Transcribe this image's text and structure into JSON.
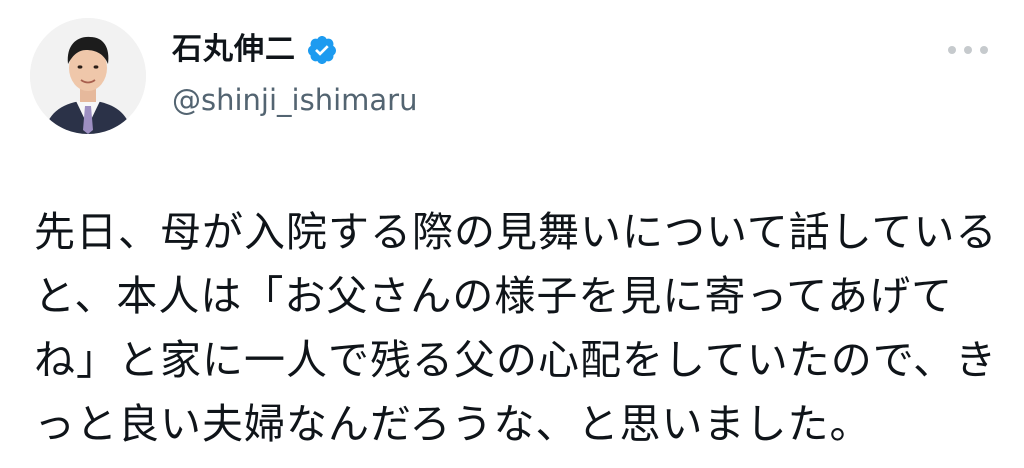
{
  "author": {
    "display_name": "石丸伸二",
    "handle": "@shinji_ishimaru",
    "verified": true,
    "avatar_icon": "profile-photo"
  },
  "menu": {
    "icon": "more-horizontal-icon"
  },
  "tweet": {
    "lines": [
      "先日、母が入院する際の見舞いについて話している",
      "と、本人は「お父さんの様子を見に寄ってあげて",
      "ね」と家に一人で残る父の心配をしていたので、き",
      "っと良い夫婦なんだろうな、と思いました。"
    ]
  },
  "colors": {
    "verified_badge": "#1d9bf0",
    "handle_text": "#536471",
    "body_text": "#0f1419",
    "more_dots": "#c6cacd"
  }
}
